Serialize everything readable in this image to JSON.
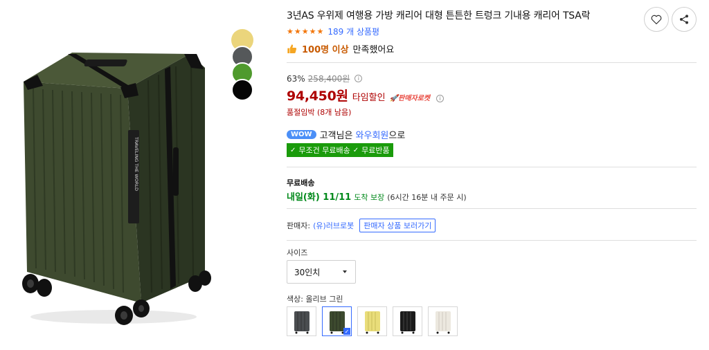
{
  "product": {
    "title": "3년AS 우위제 여행용 가방 캐리어 대형 튼튼한 트렁크 기내용 캐리어 TSA락",
    "review_count": "189 개 상품평",
    "satisfy_strong": "100명 이상",
    "satisfy_text": "만족했어요",
    "star_count": 5,
    "main_image_colors": {
      "body": "#3d4a2f",
      "dark": "#2a3320",
      "trim": "#111111",
      "highlight": "#5c6a48"
    },
    "luggage_text": "TRAVELING THE WORLD"
  },
  "gallery": {
    "swatches": [
      "yellow",
      "gray",
      "green",
      "black"
    ]
  },
  "price": {
    "discount": "63%",
    "original": "258,400원",
    "sale": "94,450원",
    "timesale": "타임할인",
    "rocket_label": "판매자로켓"
  },
  "stock": {
    "text": "품절임박 (8개 남음)"
  },
  "wow": {
    "badge": "WOW",
    "prefix": "고객님은 ",
    "link": "와우회원",
    "suffix": "으로"
  },
  "benefits": {
    "free_shipping": "무조건 무료배송",
    "free_return": "무료반품"
  },
  "shipping": {
    "label": "무료배송",
    "date": "내일(화) 11/11",
    "guarantee": "도착 보장",
    "note": "(6시간 16분 내 주문 시)"
  },
  "seller": {
    "label": "판매자:",
    "name": "(유)러브로봇",
    "button": "판매자 상품 보러가기"
  },
  "size": {
    "label": "사이즈",
    "selected": "30인치"
  },
  "color": {
    "label": "색상: 올리브 그린",
    "options": [
      {
        "name": "gray",
        "hex": "#4a4d50"
      },
      {
        "name": "olive-green",
        "hex": "#3d4a2f",
        "selected": true
      },
      {
        "name": "yellow",
        "hex": "#e9dd7a"
      },
      {
        "name": "black",
        "hex": "#1b1b1b"
      },
      {
        "name": "white",
        "hex": "#ece8df"
      }
    ]
  },
  "colors": {
    "price_red": "#ae0000",
    "link_blue": "#346aff",
    "benefit_green": "#1a9b0b",
    "ship_green": "#00891a",
    "star_orange": "#f2760b"
  }
}
